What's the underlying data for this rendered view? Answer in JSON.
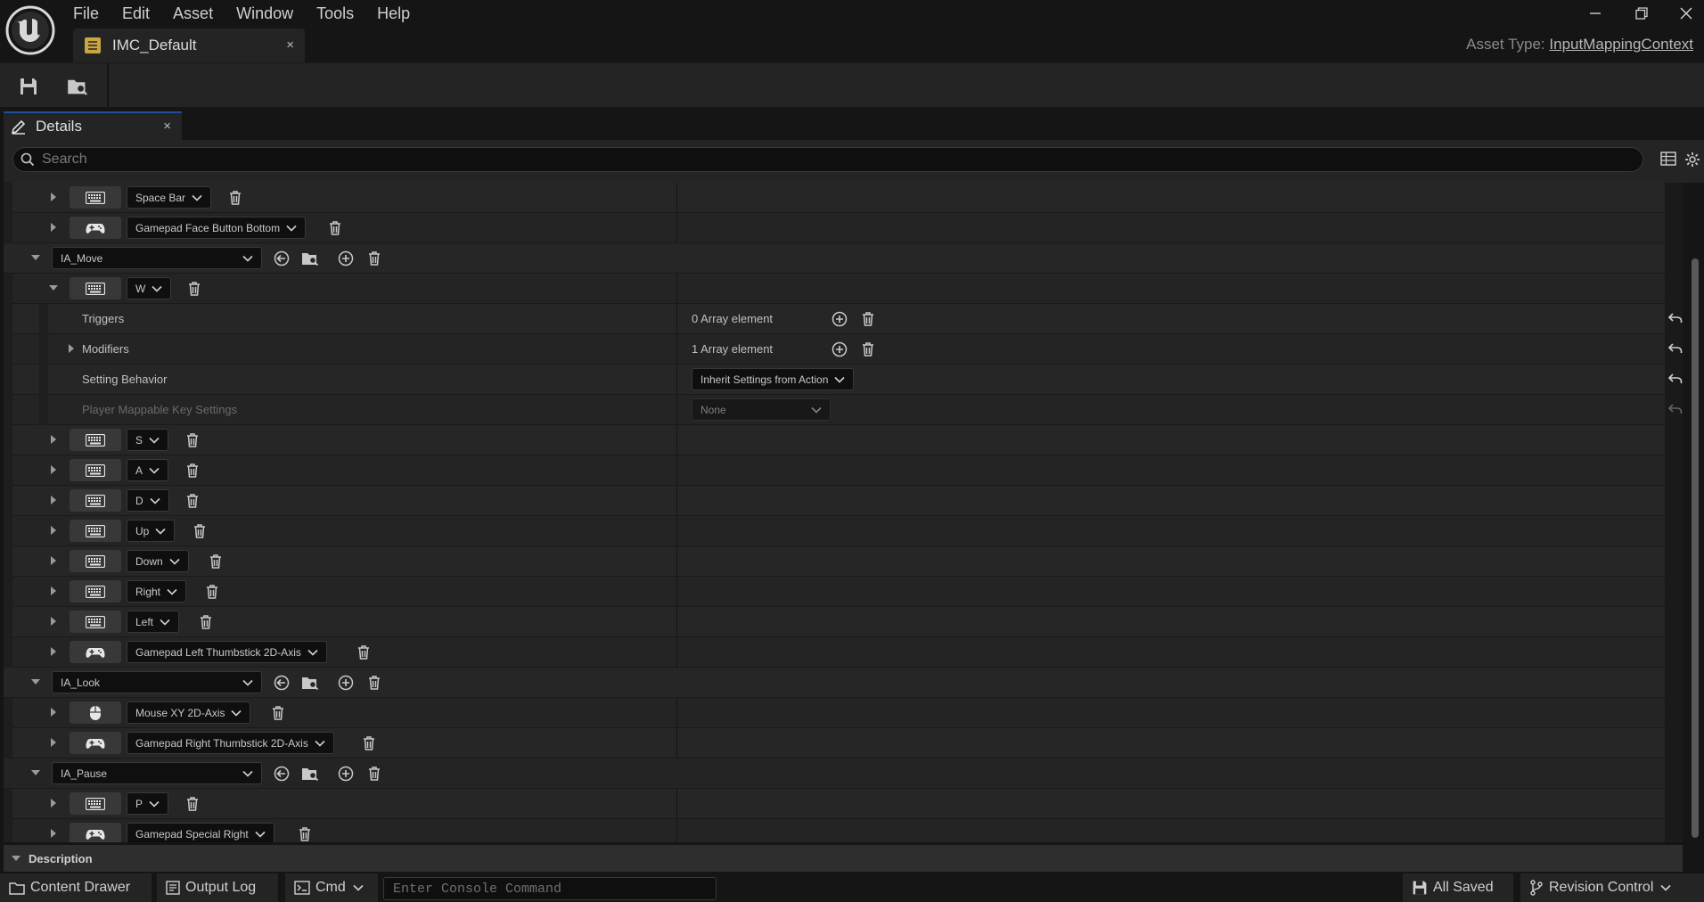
{
  "menu": [
    "File",
    "Edit",
    "Asset",
    "Window",
    "Tools",
    "Help"
  ],
  "window_controls": {
    "minimize": "minimize-icon",
    "restore": "restore-icon",
    "close": "close-icon"
  },
  "doc_tab": {
    "label": "IMC_Default",
    "close": "×"
  },
  "asset_type": {
    "label": "Asset Type:",
    "value": "InputMappingContext"
  },
  "toolbar": {
    "save_icon": "save-icon",
    "browse_icon": "browse-icon"
  },
  "details_tab": {
    "label": "Details",
    "close": "×"
  },
  "search": {
    "placeholder": "Search"
  },
  "rows": {
    "space_bar": "Space Bar",
    "gamepad_face_bottom": "Gamepad Face Button Bottom",
    "ia_move": "IA_Move",
    "w": "W",
    "triggers_label": "Triggers",
    "triggers_value": "0 Array element",
    "modifiers_label": "Modifiers",
    "modifiers_value": "1 Array element",
    "setting_behavior_label": "Setting Behavior",
    "setting_behavior_value": "Inherit Settings from Action",
    "player_mappable_label": "Player Mappable Key Settings",
    "player_mappable_value": "None",
    "s": "S",
    "a": "A",
    "d": "D",
    "up": "Up",
    "down": "Down",
    "right": "Right",
    "left": "Left",
    "gamepad_left_thumb": "Gamepad Left Thumbstick 2D-Axis",
    "ia_look": "IA_Look",
    "mouse_xy": "Mouse XY 2D-Axis",
    "gamepad_right_thumb": "Gamepad Right Thumbstick 2D-Axis",
    "ia_pause": "IA_Pause",
    "p": "P",
    "gamepad_special_right": "Gamepad Special Right"
  },
  "description": {
    "label": "Description"
  },
  "statusbar": {
    "content_drawer": "Content Drawer",
    "output_log": "Output Log",
    "cmd": "Cmd",
    "console_placeholder": "Enter Console Command",
    "all_saved": "All Saved",
    "revision_control": "Revision Control"
  },
  "colors": {
    "accent": "#1f4e9a",
    "background": "#151515",
    "panel": "#242424"
  }
}
